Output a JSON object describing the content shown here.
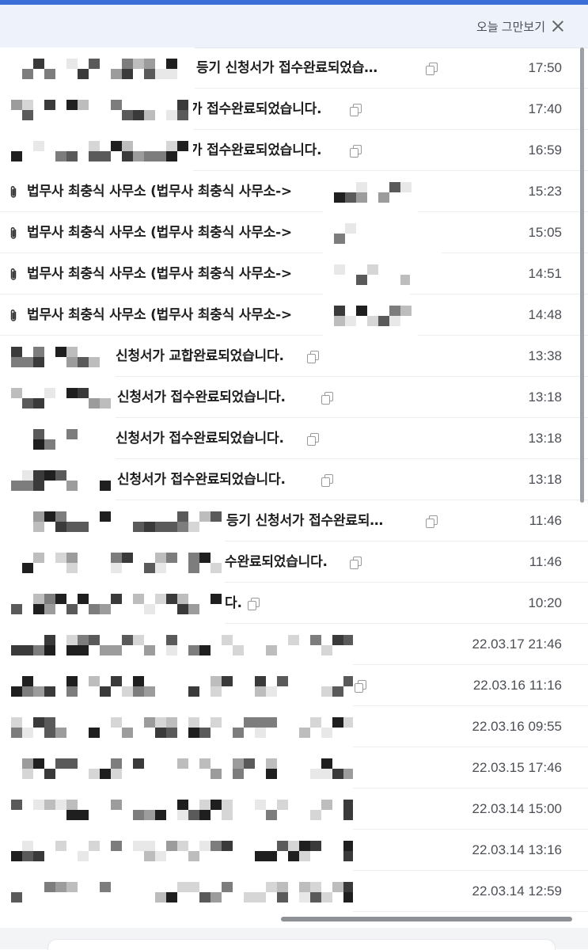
{
  "notice": {
    "dismiss_label": "오늘 그만보기"
  },
  "mails": [
    {
      "subject": "등기 신청서가 접수완료되었습…",
      "time": "17:50",
      "copy": true,
      "attachment": false
    },
    {
      "subject": "가 접수완료되었습니다.",
      "time": "17:40",
      "copy": true,
      "attachment": false
    },
    {
      "subject": "가 접수완료되었습니다.",
      "time": "16:59",
      "copy": true,
      "attachment": false
    },
    {
      "subject": "법무사 최충식 사무소 (법무사 최충식 사무소->",
      "time": "15:23",
      "copy": false,
      "attachment": true
    },
    {
      "subject": "법무사 최충식 사무소 (법무사 최충식 사무소->",
      "time": "15:05",
      "copy": false,
      "attachment": true
    },
    {
      "subject": "법무사 최충식 사무소 (법무사 최충식 사무소->",
      "time": "14:51",
      "copy": false,
      "attachment": true
    },
    {
      "subject": "법무사 최충식 사무소 (법무사 최충식 사무소->",
      "time": "14:48",
      "copy": false,
      "attachment": true
    },
    {
      "subject": "신청서가 교합완료되었습니다.",
      "time": "13:38",
      "copy": true,
      "attachment": false
    },
    {
      "subject": "신청서가 접수완료되었습니다.",
      "time": "13:18",
      "copy": true,
      "attachment": false
    },
    {
      "subject": "신청서가 접수완료되었습니다.",
      "time": "13:18",
      "copy": true,
      "attachment": false
    },
    {
      "subject": "신청서가 접수완료되었습니다.",
      "time": "13:18",
      "copy": true,
      "attachment": false
    },
    {
      "subject": "등기 신청서가 접수완료되…",
      "time": "11:46",
      "copy": true,
      "attachment": false
    },
    {
      "subject": "수완료되었습니다.",
      "time": "11:46",
      "copy": true,
      "attachment": false
    },
    {
      "subject": "다.",
      "time": "10:20",
      "copy": true,
      "attachment": false
    },
    {
      "subject": "",
      "time": "22.03.17 21:46",
      "copy": false,
      "attachment": false
    },
    {
      "subject": "",
      "time": "22.03.16 11:16",
      "copy": true,
      "attachment": false
    },
    {
      "subject": "",
      "time": "22.03.16 09:55",
      "copy": false,
      "attachment": false
    },
    {
      "subject": "",
      "time": "22.03.15 17:46",
      "copy": false,
      "attachment": false
    },
    {
      "subject": "",
      "time": "22.03.14 15:00",
      "copy": false,
      "attachment": false
    },
    {
      "subject": "",
      "time": "22.03.14 13:16",
      "copy": false,
      "attachment": false
    },
    {
      "subject": "",
      "time": "22.03.14 12:59",
      "copy": false,
      "attachment": false
    }
  ],
  "colors": {
    "accent": "#3a6fd8",
    "notice_bg": "#eef3fb",
    "mosaic_dark": "#2b2b2b",
    "mosaic_mid": "#6e6e6e",
    "mosaic_light": "#c9c9c9"
  },
  "icons": {
    "close": "close-icon",
    "copy": "copy-icon",
    "attachment": "paperclip-icon"
  }
}
